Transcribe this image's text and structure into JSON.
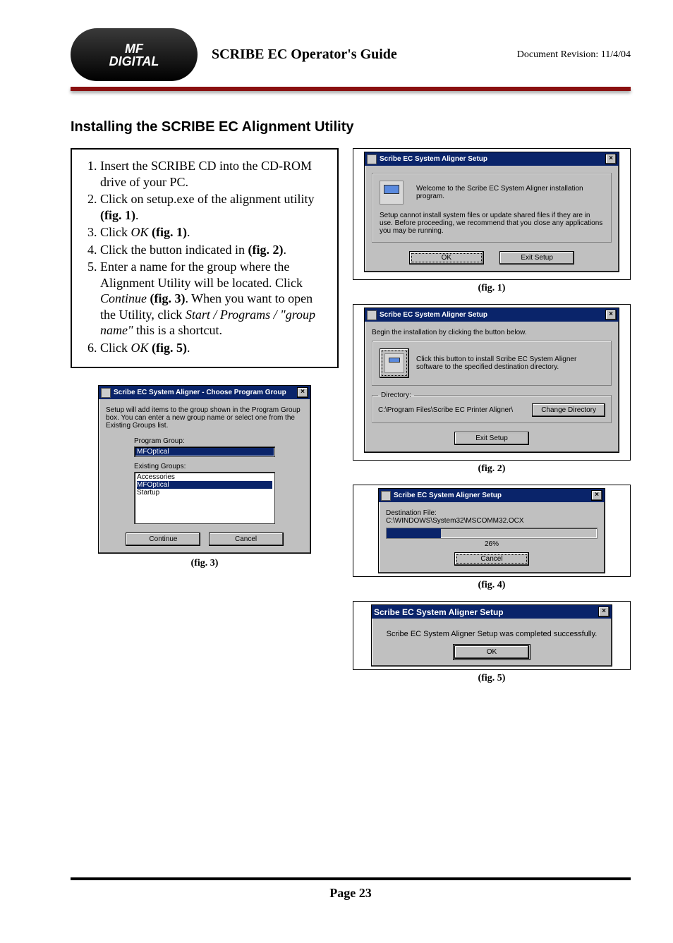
{
  "header": {
    "logo_line1": "MF",
    "logo_line2": "DIGITAL",
    "title": "SCRIBE EC Operator's Guide",
    "revision": "Document Revision: 11/4/04"
  },
  "section_title": "Installing the SCRIBE EC Alignment Utility",
  "steps": {
    "s1a": "Insert the SCRIBE CD into the CD-ROM drive of your PC.",
    "s2a": "Click on setup.exe of the alignment utility ",
    "s2b": "(fig. 1)",
    "s2c": ".",
    "s3a": "Click ",
    "s3b": "OK",
    "s3c": " (fig. 1)",
    "s3d": ".",
    "s4a": "Click the button indicated in ",
    "s4b": "(fig. 2)",
    "s4c": ".",
    "s5a": "Enter a name for the group where the Alignment Utility will be located. Click ",
    "s5b": "Continue",
    "s5c": " (fig. 3)",
    "s5d": ". When you want to open the Utility, click ",
    "s5e": "Start / Programs / \"group name\"",
    "s5f": "  this is a shortcut.",
    "s6a": "Click ",
    "s6b": "OK",
    "s6c": " (fig. 5)",
    "s6d": "."
  },
  "fig1": {
    "title": "Scribe EC System Aligner Setup",
    "welcome": "Welcome to the Scribe EC System Aligner installation program.",
    "body": "Setup cannot install system files or update shared files if they are in use. Before proceeding, we recommend that you close any applications you may be running.",
    "ok": "OK",
    "exit": "Exit Setup",
    "caption": "(fig. 1)"
  },
  "fig2": {
    "title": "Scribe EC System Aligner Setup",
    "begin": "Begin the installation by clicking the button below.",
    "hint": "Click this button to install Scribe EC System Aligner software to the specified destination directory.",
    "dir_legend": "Directory:",
    "dir_path": "C:\\Program Files\\Scribe EC Printer Aligner\\",
    "change": "Change Directory",
    "exit": "Exit Setup",
    "caption": "(fig. 2)"
  },
  "fig3": {
    "title": "Scribe EC System Aligner - Choose Program Group",
    "intro": "Setup will add items to the group shown in the Program Group box. You can enter a new group name or select one from the Existing Groups list.",
    "pg_label": "Program Group:",
    "pg_value": "MFOptical",
    "eg_label": "Existing Groups:",
    "eg1": "Accessories",
    "eg2": "MFOptical",
    "eg3": "Startup",
    "continue": "Continue",
    "cancel": "Cancel",
    "caption": "(fig. 3)"
  },
  "fig4": {
    "title": "Scribe EC System Aligner Setup",
    "dest_lbl": "Destination File:",
    "dest_path": "C:\\WINDOWS\\System32\\MSCOMM32.OCX",
    "percent": "26%",
    "percent_num": 26,
    "cancel": "Cancel",
    "caption": "(fig. 4)"
  },
  "fig5": {
    "title": "Scribe EC System Aligner Setup",
    "msg": "Scribe EC System Aligner Setup was completed successfully.",
    "ok": "OK",
    "caption": "(fig. 5)"
  },
  "page_label": "Page 23",
  "close_x": "×"
}
